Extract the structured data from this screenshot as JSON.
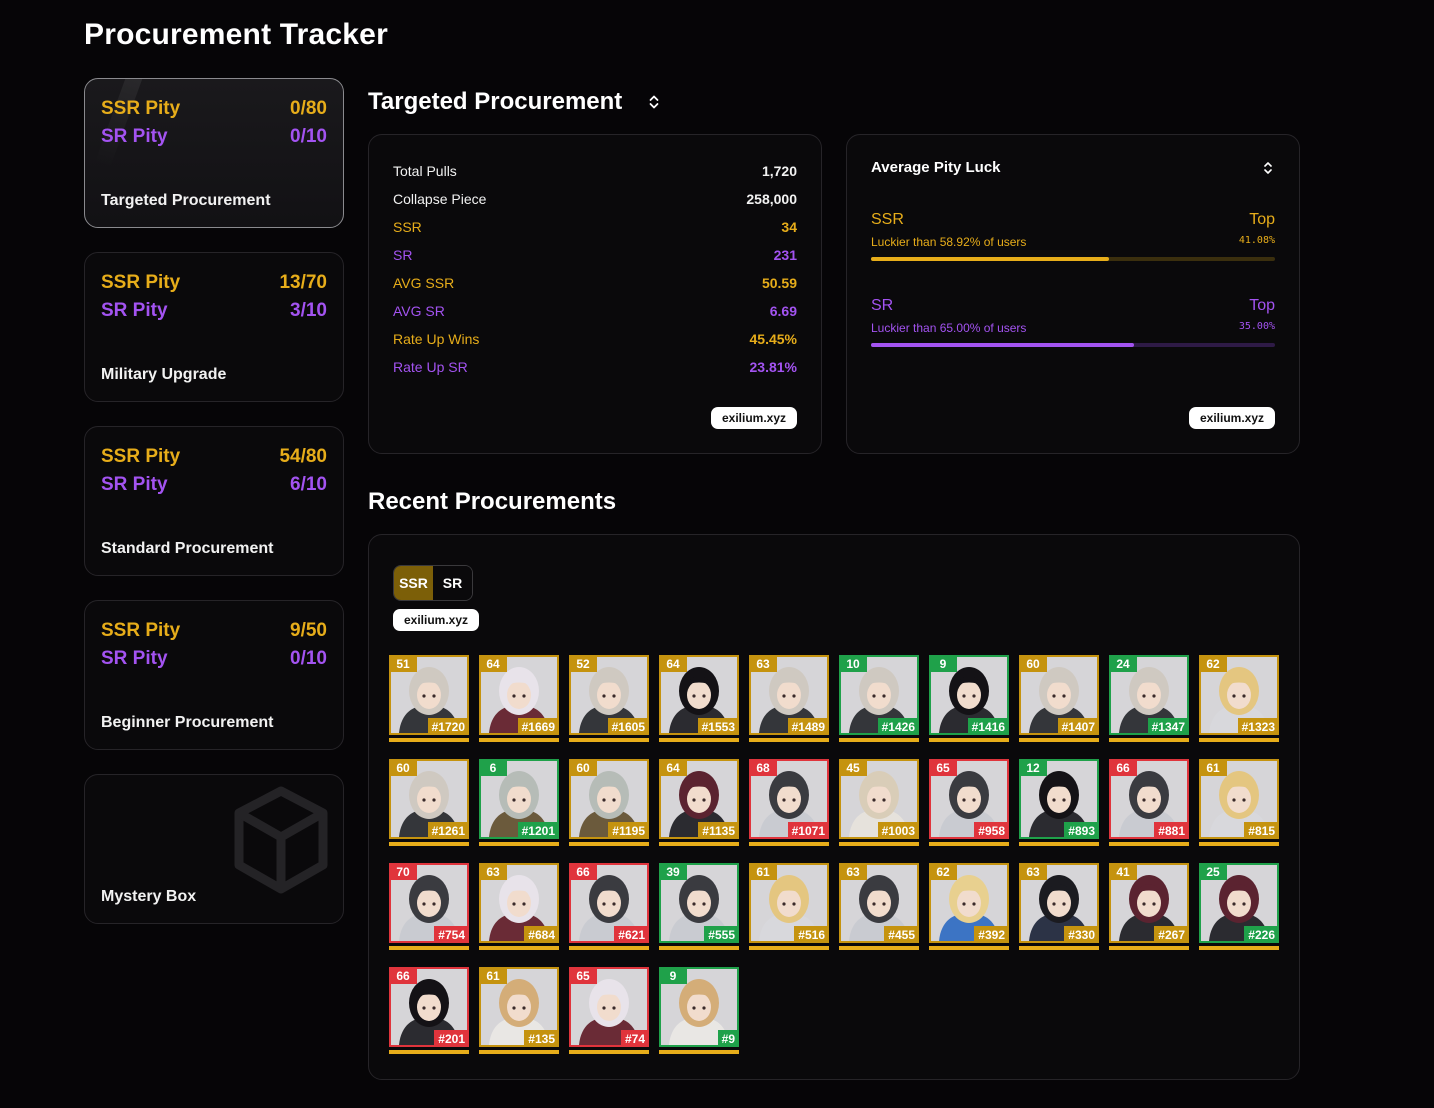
{
  "page": {
    "title": "Procurement Tracker"
  },
  "sidebar": [
    {
      "name": "Targeted Procurement",
      "ssr_label": "SSR Pity",
      "ssr_value": "0/80",
      "sr_label": "SR Pity",
      "sr_value": "0/10"
    },
    {
      "name": "Military Upgrade",
      "ssr_label": "SSR Pity",
      "ssr_value": "13/70",
      "sr_label": "SR Pity",
      "sr_value": "3/10"
    },
    {
      "name": "Standard Procurement",
      "ssr_label": "SSR Pity",
      "ssr_value": "54/80",
      "sr_label": "SR Pity",
      "sr_value": "6/10"
    },
    {
      "name": "Beginner Procurement",
      "ssr_label": "SSR Pity",
      "ssr_value": "9/50",
      "sr_label": "SR Pity",
      "sr_value": "0/10"
    },
    {
      "name": "Mystery Box"
    }
  ],
  "targeted": {
    "title": "Targeted Procurement",
    "stats": [
      {
        "label": "Total Pulls",
        "value": "1,720",
        "tone": "white"
      },
      {
        "label": "Collapse Piece",
        "value": "258,000",
        "tone": "white"
      },
      {
        "label": "SSR",
        "value": "34",
        "tone": "gold"
      },
      {
        "label": "SR",
        "value": "231",
        "tone": "purple"
      },
      {
        "label": "AVG SSR",
        "value": "50.59",
        "tone": "gold"
      },
      {
        "label": "AVG SR",
        "value": "6.69",
        "tone": "purple"
      },
      {
        "label": "Rate Up Wins",
        "value": "45.45%",
        "tone": "gold"
      },
      {
        "label": "Rate Up SR",
        "value": "23.81%",
        "tone": "purple"
      }
    ],
    "watermark": "exilium.xyz"
  },
  "luck": {
    "title": "Average Pity Luck",
    "ssr": {
      "label": "SSR",
      "sub": "Luckier than 58.92% of users",
      "top_label": "Top",
      "top_pct": "41.08%",
      "fill": 0.5892
    },
    "sr": {
      "label": "SR",
      "sub": "Luckier than 65.00% of users",
      "top_label": "Top",
      "top_pct": "35.00%",
      "fill": 0.65
    },
    "watermark": "exilium.xyz"
  },
  "recent": {
    "title": "Recent Procurements",
    "toggle": {
      "ssr": "SSR",
      "sr": "SR"
    },
    "watermark": "exilium.xyz",
    "tiles": [
      {
        "pity": "51",
        "num": "#1720",
        "tone": "gold",
        "hair": "#cfc9c1",
        "outfit": "#34363a"
      },
      {
        "pity": "64",
        "num": "#1669",
        "tone": "gold",
        "hair": "#e8e3ea",
        "outfit": "#6a2b36"
      },
      {
        "pity": "52",
        "num": "#1605",
        "tone": "gold",
        "hair": "#cfc9c1",
        "outfit": "#34363a"
      },
      {
        "pity": "64",
        "num": "#1553",
        "tone": "gold",
        "hair": "#141216",
        "outfit": "#2b2b30"
      },
      {
        "pity": "63",
        "num": "#1489",
        "tone": "gold",
        "hair": "#cfc9c1",
        "outfit": "#34363a"
      },
      {
        "pity": "10",
        "num": "#1426",
        "tone": "green",
        "hair": "#cfc9c1",
        "outfit": "#34363a"
      },
      {
        "pity": "9",
        "num": "#1416",
        "tone": "green",
        "hair": "#141216",
        "outfit": "#2b2b30"
      },
      {
        "pity": "60",
        "num": "#1407",
        "tone": "gold",
        "hair": "#cfc9c1",
        "outfit": "#34363a"
      },
      {
        "pity": "24",
        "num": "#1347",
        "tone": "green",
        "hair": "#cfc9c1",
        "outfit": "#34363a"
      },
      {
        "pity": "62",
        "num": "#1323",
        "tone": "gold",
        "hair": "#e4c680",
        "outfit": "#d8d8dc"
      },
      {
        "pity": "60",
        "num": "#1261",
        "tone": "gold",
        "hair": "#cfc9c1",
        "outfit": "#34363a"
      },
      {
        "pity": "6",
        "num": "#1201",
        "tone": "green",
        "hair": "#b6bcb7",
        "outfit": "#6b5a3c"
      },
      {
        "pity": "60",
        "num": "#1195",
        "tone": "gold",
        "hair": "#b6bcb7",
        "outfit": "#6b5a3c"
      },
      {
        "pity": "64",
        "num": "#1135",
        "tone": "gold",
        "hair": "#5b2330",
        "outfit": "#2b2b30"
      },
      {
        "pity": "68",
        "num": "#1071",
        "tone": "red",
        "hair": "#3a3b40",
        "outfit": "#c9cbd1"
      },
      {
        "pity": "45",
        "num": "#1003",
        "tone": "gold",
        "hair": "#d9cdb8",
        "outfit": "#e6e2dc"
      },
      {
        "pity": "65",
        "num": "#958",
        "tone": "red",
        "hair": "#3a3b40",
        "outfit": "#c9cbd1"
      },
      {
        "pity": "12",
        "num": "#893",
        "tone": "green",
        "hair": "#141216",
        "outfit": "#2b2b30"
      },
      {
        "pity": "66",
        "num": "#881",
        "tone": "red",
        "hair": "#3a3b40",
        "outfit": "#c9cbd1"
      },
      {
        "pity": "61",
        "num": "#815",
        "tone": "gold",
        "hair": "#e4c680",
        "outfit": "#d8d8dc"
      },
      {
        "pity": "70",
        "num": "#754",
        "tone": "red",
        "hair": "#3a3b40",
        "outfit": "#c9cbd1"
      },
      {
        "pity": "63",
        "num": "#684",
        "tone": "gold",
        "hair": "#e8e3ea",
        "outfit": "#6a2b36"
      },
      {
        "pity": "66",
        "num": "#621",
        "tone": "red",
        "hair": "#3a3b40",
        "outfit": "#c9cbd1"
      },
      {
        "pity": "39",
        "num": "#555",
        "tone": "green",
        "hair": "#3a3b40",
        "outfit": "#c9cbd1"
      },
      {
        "pity": "61",
        "num": "#516",
        "tone": "gold",
        "hair": "#e4c680",
        "outfit": "#d8d8dc"
      },
      {
        "pity": "63",
        "num": "#455",
        "tone": "gold",
        "hair": "#3a3b40",
        "outfit": "#c9cbd1"
      },
      {
        "pity": "62",
        "num": "#392",
        "tone": "gold",
        "hair": "#e8d08f",
        "outfit": "#3c74c4"
      },
      {
        "pity": "63",
        "num": "#330",
        "tone": "gold",
        "hair": "#1b1b20",
        "outfit": "#2c3346"
      },
      {
        "pity": "41",
        "num": "#267",
        "tone": "gold",
        "hair": "#5b2330",
        "outfit": "#2b2b30"
      },
      {
        "pity": "25",
        "num": "#226",
        "tone": "green",
        "hair": "#5b2330",
        "outfit": "#2b2b30"
      },
      {
        "pity": "66",
        "num": "#201",
        "tone": "red",
        "hair": "#141216",
        "outfit": "#2b2b30"
      },
      {
        "pity": "61",
        "num": "#135",
        "tone": "gold",
        "hair": "#d4ad78",
        "outfit": "#e9e7e4"
      },
      {
        "pity": "65",
        "num": "#74",
        "tone": "red",
        "hair": "#e8e3ea",
        "outfit": "#6a2b36"
      },
      {
        "pity": "9",
        "num": "#9",
        "tone": "green",
        "hair": "#d4ad78",
        "outfit": "#e9e7e4"
      }
    ]
  },
  "colors": {
    "ssr": "#e7ad1a",
    "sr": "#a353f1",
    "green": "#1fa14a",
    "red": "#e0343c",
    "gold_border": "#c5930f"
  }
}
